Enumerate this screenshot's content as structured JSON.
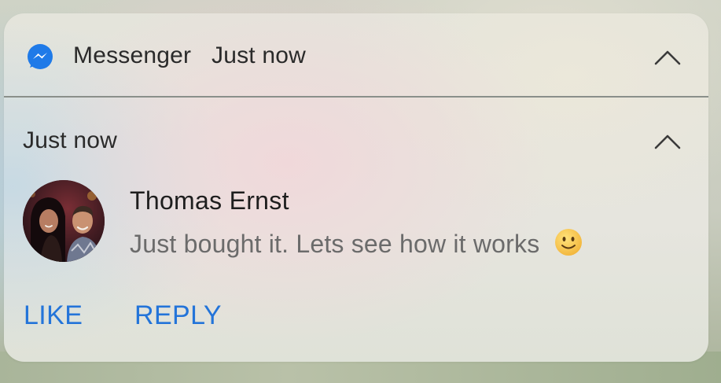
{
  "notification": {
    "app_name": "Messenger",
    "header_time": "Just now",
    "section_time": "Just now",
    "sender": "Thomas Ernst",
    "message": "Just bought it. Lets see how it works",
    "emoji": "slightly-smiling-face-icon",
    "actions": {
      "like": "LIKE",
      "reply": "REPLY"
    }
  },
  "colors": {
    "accent": "#2374d9",
    "messenger_icon": "#1f7ae8",
    "title_text": "#2a2a2a",
    "message_text": "#6b6b6b"
  }
}
